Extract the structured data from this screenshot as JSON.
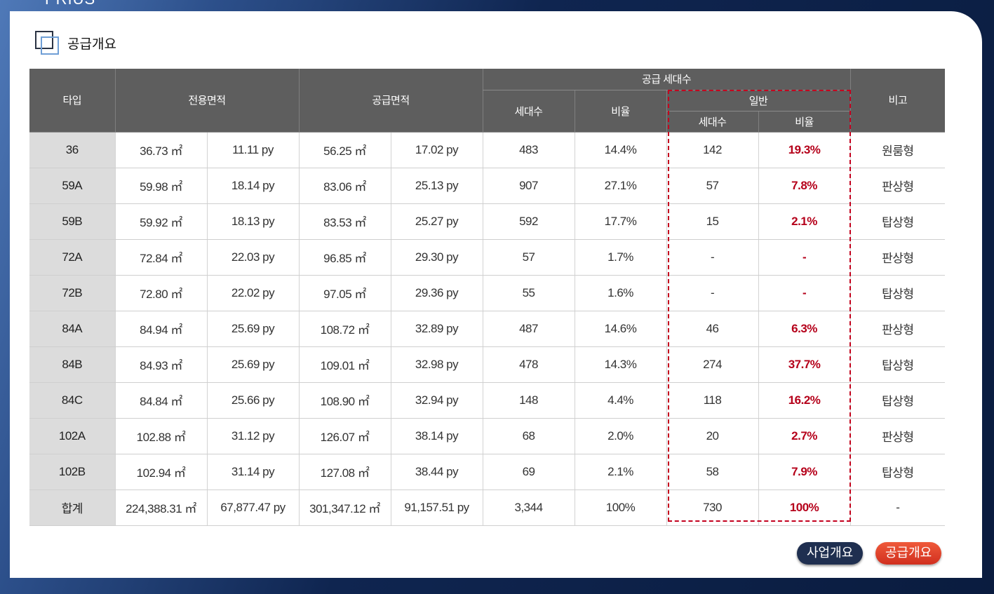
{
  "brand": "PRIUS",
  "section_title": "공급개요",
  "headers": {
    "type": "타입",
    "exclusive_area": "전용면적",
    "supply_area": "공급면적",
    "supply_units": "공급 세대수",
    "units": "세대수",
    "ratio": "비율",
    "general": "일반",
    "general_units": "세대수",
    "general_ratio": "비율",
    "note": "비고"
  },
  "rows": [
    {
      "type": "36",
      "ex_m2": "36.73 ㎡",
      "ex_py": "11.11 py",
      "su_m2": "56.25 ㎡",
      "su_py": "17.02 py",
      "units": "483",
      "ratio": "14.4%",
      "g_units": "142",
      "g_ratio": "19.3%",
      "note": "원룸형"
    },
    {
      "type": "59A",
      "ex_m2": "59.98 ㎡",
      "ex_py": "18.14 py",
      "su_m2": "83.06 ㎡",
      "su_py": "25.13 py",
      "units": "907",
      "ratio": "27.1%",
      "g_units": "57",
      "g_ratio": "7.8%",
      "note": "판상형"
    },
    {
      "type": "59B",
      "ex_m2": "59.92 ㎡",
      "ex_py": "18.13 py",
      "su_m2": "83.53 ㎡",
      "su_py": "25.27 py",
      "units": "592",
      "ratio": "17.7%",
      "g_units": "15",
      "g_ratio": "2.1%",
      "note": "탑상형"
    },
    {
      "type": "72A",
      "ex_m2": "72.84 ㎡",
      "ex_py": "22.03 py",
      "su_m2": "96.85 ㎡",
      "su_py": "29.30 py",
      "units": "57",
      "ratio": "1.7%",
      "g_units": "-",
      "g_ratio": "-",
      "note": "판상형"
    },
    {
      "type": "72B",
      "ex_m2": "72.80 ㎡",
      "ex_py": "22.02 py",
      "su_m2": "97.05 ㎡",
      "su_py": "29.36 py",
      "units": "55",
      "ratio": "1.6%",
      "g_units": "-",
      "g_ratio": "-",
      "note": "탑상형"
    },
    {
      "type": "84A",
      "ex_m2": "84.94 ㎡",
      "ex_py": "25.69 py",
      "su_m2": "108.72 ㎡",
      "su_py": "32.89 py",
      "units": "487",
      "ratio": "14.6%",
      "g_units": "46",
      "g_ratio": "6.3%",
      "note": "판상형"
    },
    {
      "type": "84B",
      "ex_m2": "84.93 ㎡",
      "ex_py": "25.69 py",
      "su_m2": "109.01 ㎡",
      "su_py": "32.98 py",
      "units": "478",
      "ratio": "14.3%",
      "g_units": "274",
      "g_ratio": "37.7%",
      "note": "탑상형"
    },
    {
      "type": "84C",
      "ex_m2": "84.84 ㎡",
      "ex_py": "25.66 py",
      "su_m2": "108.90 ㎡",
      "su_py": "32.94 py",
      "units": "148",
      "ratio": "4.4%",
      "g_units": "118",
      "g_ratio": "16.2%",
      "note": "탑상형"
    },
    {
      "type": "102A",
      "ex_m2": "102.88 ㎡",
      "ex_py": "31.12 py",
      "su_m2": "126.07 ㎡",
      "su_py": "38.14 py",
      "units": "68",
      "ratio": "2.0%",
      "g_units": "20",
      "g_ratio": "2.7%",
      "note": "판상형"
    },
    {
      "type": "102B",
      "ex_m2": "102.94 ㎡",
      "ex_py": "31.14 py",
      "su_m2": "127.08 ㎡",
      "su_py": "38.44 py",
      "units": "69",
      "ratio": "2.1%",
      "g_units": "58",
      "g_ratio": "7.9%",
      "note": "탑상형"
    },
    {
      "type": "합계",
      "ex_m2": "224,388.31 ㎡",
      "ex_py": "67,877.47 py",
      "su_m2": "301,347.12 ㎡",
      "su_py": "91,157.51 py",
      "units": "3,344",
      "ratio": "100%",
      "g_units": "730",
      "g_ratio": "100%",
      "note": "-"
    }
  ],
  "buttons": {
    "project_overview": "사업개요",
    "supply_overview": "공급개요"
  },
  "colors": {
    "header_bg": "#5e5e5e",
    "highlight_red": "#b5001a",
    "button_dark": "#1f2f50",
    "button_red": "#e0442a"
  }
}
